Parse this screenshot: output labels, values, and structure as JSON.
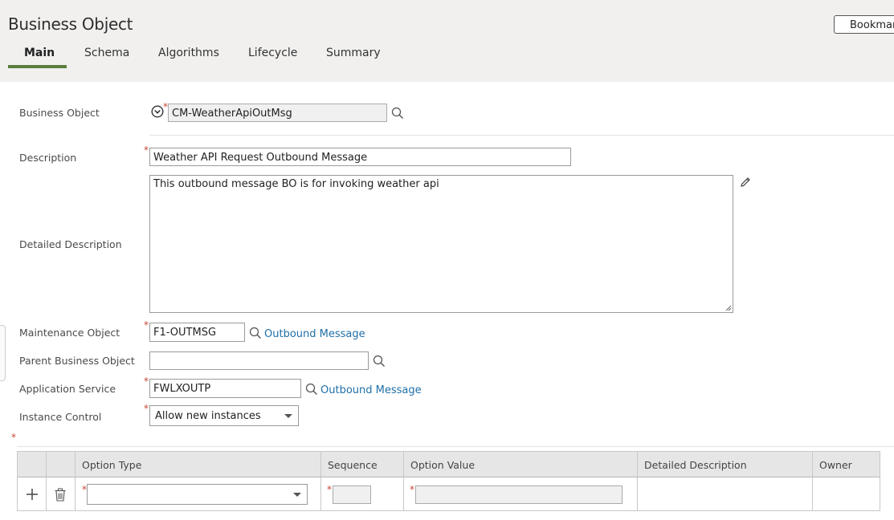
{
  "header": {
    "title": "Business Object",
    "bookmark_label": "Bookmark",
    "tabs": [
      {
        "label": "Main"
      },
      {
        "label": "Schema"
      },
      {
        "label": "Algorithms"
      },
      {
        "label": "Lifecycle"
      },
      {
        "label": "Summary"
      }
    ],
    "active_tab": "Main"
  },
  "form": {
    "business_object": {
      "label": "Business Object",
      "value": "CM-WeatherApiOutMsg"
    },
    "description": {
      "label": "Description",
      "value": "Weather API Request Outbound Message"
    },
    "detailed_description": {
      "label": "Detailed Description",
      "value": "This outbound message BO is for invoking weather api"
    },
    "maintenance_object": {
      "label": "Maintenance Object",
      "value": "F1-OUTMSG",
      "link": "Outbound Message"
    },
    "parent_business_object": {
      "label": "Parent Business Object",
      "value": ""
    },
    "application_service": {
      "label": "Application Service",
      "value": "FWLXOUTP",
      "link": "Outbound Message"
    },
    "instance_control": {
      "label": "Instance Control",
      "value": "Allow new instances"
    }
  },
  "options_grid": {
    "columns": [
      "Option Type",
      "Sequence",
      "Option Value",
      "Detailed Description",
      "Owner"
    ],
    "rows": [
      {
        "option_type": "",
        "sequence": "",
        "option_value": "",
        "detailed_description": "",
        "owner": ""
      }
    ]
  },
  "colors": {
    "accent": "#5a7e3c",
    "link": "#1f6fa8",
    "required": "#c74634",
    "header_bg": "#f1f0ef"
  },
  "icons": [
    "chevron-circle-icon",
    "search-icon",
    "pencil-icon",
    "add-icon",
    "trash-icon",
    "chevron-down-icon"
  ]
}
